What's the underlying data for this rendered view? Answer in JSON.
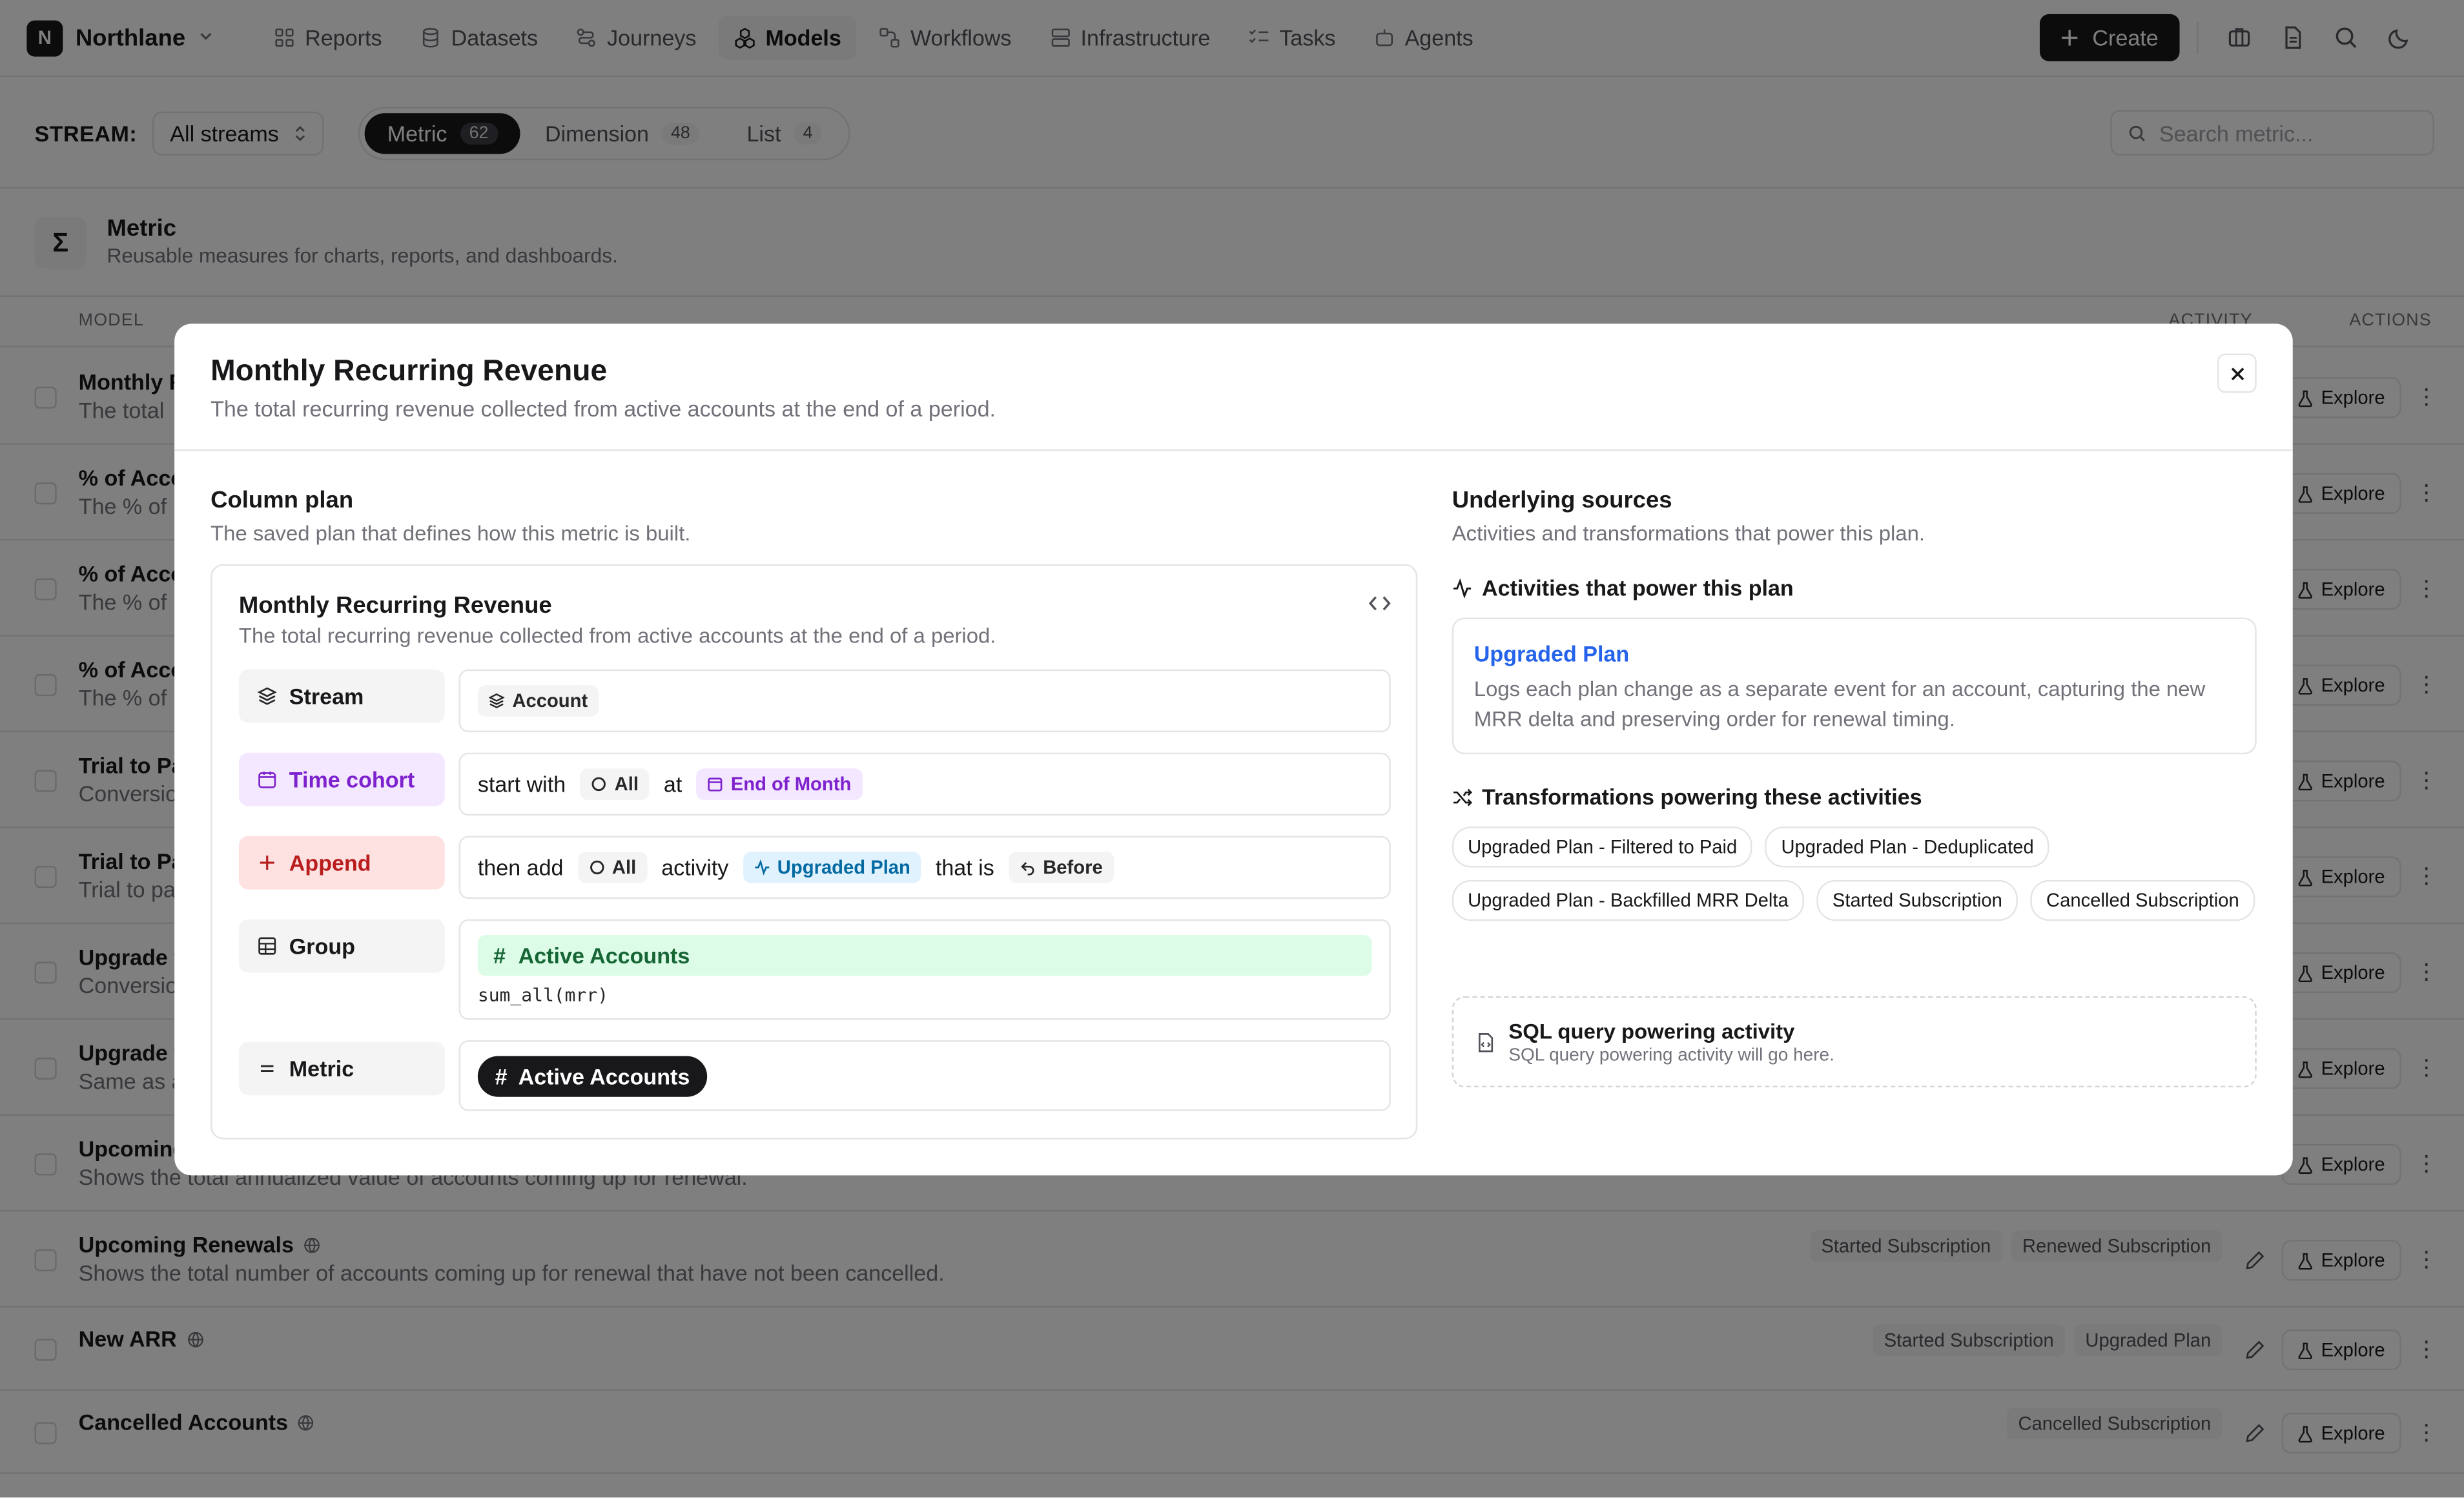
{
  "app": {
    "logo_letter": "N",
    "name": "Northlane"
  },
  "nav": [
    {
      "label": "Reports",
      "icon": "reports-icon",
      "active": false
    },
    {
      "label": "Datasets",
      "icon": "datasets-icon",
      "active": false
    },
    {
      "label": "Journeys",
      "icon": "journeys-icon",
      "active": false
    },
    {
      "label": "Models",
      "icon": "models-icon",
      "active": true
    },
    {
      "label": "Workflows",
      "icon": "workflows-icon",
      "active": false
    },
    {
      "label": "Infrastructure",
      "icon": "infrastructure-icon",
      "active": false
    },
    {
      "label": "Tasks",
      "icon": "tasks-icon",
      "active": false
    },
    {
      "label": "Agents",
      "icon": "agents-icon",
      "active": false
    }
  ],
  "header": {
    "create_label": "Create"
  },
  "filter": {
    "stream_label": "STREAM:",
    "stream_value": "All streams",
    "tabs": [
      {
        "label": "Metric",
        "count": "62",
        "active": true
      },
      {
        "label": "Dimension",
        "count": "48",
        "active": false
      },
      {
        "label": "List",
        "count": "4",
        "active": false
      }
    ],
    "search_placeholder": "Search metric..."
  },
  "section": {
    "icon": "Σ",
    "title": "Metric",
    "subtitle": "Reusable measures for charts, reports, and dashboards."
  },
  "table": {
    "headers": {
      "model": "MODEL",
      "activity": "ACTIVITY",
      "actions": "ACTIONS"
    },
    "explore_label": "Explore",
    "rows": [
      {
        "title": "Monthly R",
        "desc": "The total",
        "tags": []
      },
      {
        "title": "% of Acco",
        "desc": "The % of",
        "tags": []
      },
      {
        "title": "% of Acco",
        "desc": "The % of",
        "tags": []
      },
      {
        "title": "% of Acco",
        "desc": "The % of",
        "tags": []
      },
      {
        "title": "Trial to Pa",
        "desc": "Conversio",
        "tags": []
      },
      {
        "title": "Trial to Pa",
        "desc": "Trial to pa",
        "tags": []
      },
      {
        "title": "Upgrade t",
        "desc": "Conversio",
        "tags": []
      },
      {
        "title": "Upgrade t",
        "desc": "Same as a",
        "tags": []
      },
      {
        "title": "Upcoming",
        "desc": "Shows the total annualized value of accounts coming up for renewal.",
        "tags": []
      },
      {
        "title": "Upcoming Renewals",
        "desc": "Shows the total number of accounts coming up for renewal that have not been cancelled.",
        "tags": [
          "Started Subscription",
          "Renewed Subscription"
        ]
      },
      {
        "title": "New ARR",
        "desc": "",
        "tags": [
          "Started Subscription",
          "Upgraded Plan"
        ]
      },
      {
        "title": "Cancelled Accounts",
        "desc": "",
        "tags": [
          "Cancelled Subscription"
        ]
      }
    ]
  },
  "modal": {
    "title": "Monthly Recurring Revenue",
    "subtitle": "The total recurring revenue collected from active accounts at the end of a period.",
    "left": {
      "heading": "Column plan",
      "subheading": "The saved plan that defines how this metric is built.",
      "plan_title": "Monthly Recurring Revenue",
      "plan_subtitle": "The total recurring revenue collected from active accounts at the end of a period.",
      "stream": {
        "label": "Stream",
        "value": "Account"
      },
      "cohort": {
        "label": "Time cohort",
        "t1": "start with",
        "chip1": "All",
        "t2": "at",
        "chip2": "End of Month"
      },
      "append": {
        "label": "Append",
        "t1": "then add",
        "chip1": "All",
        "t2": "activity",
        "chip2": "Upgraded Plan",
        "t3": "that is",
        "chip3": "Before"
      },
      "group": {
        "label": "Group",
        "bar": "Active Accounts",
        "code": "sum_all(mrr)"
      },
      "metric": {
        "label": "Metric",
        "pill": "Active Accounts"
      }
    },
    "right": {
      "heading": "Underlying sources",
      "subheading": "Activities and transformations that power this plan.",
      "activities_heading": "Activities that power this plan",
      "activity_name": "Upgraded Plan",
      "activity_desc": "Logs each plan change as a separate event for an account, capturing the new MRR delta and preserving order for renewal timing.",
      "transforms_heading": "Transformations powering these activities",
      "transforms": [
        "Upgraded Plan - Filtered to Paid",
        "Upgraded Plan - Deduplicated",
        "Upgraded Plan - Backfilled MRR Delta",
        "Started Subscription",
        "Cancelled Subscription"
      ],
      "sql_title": "SQL query powering activity",
      "sql_sub": "SQL query powering activity will go here."
    }
  }
}
